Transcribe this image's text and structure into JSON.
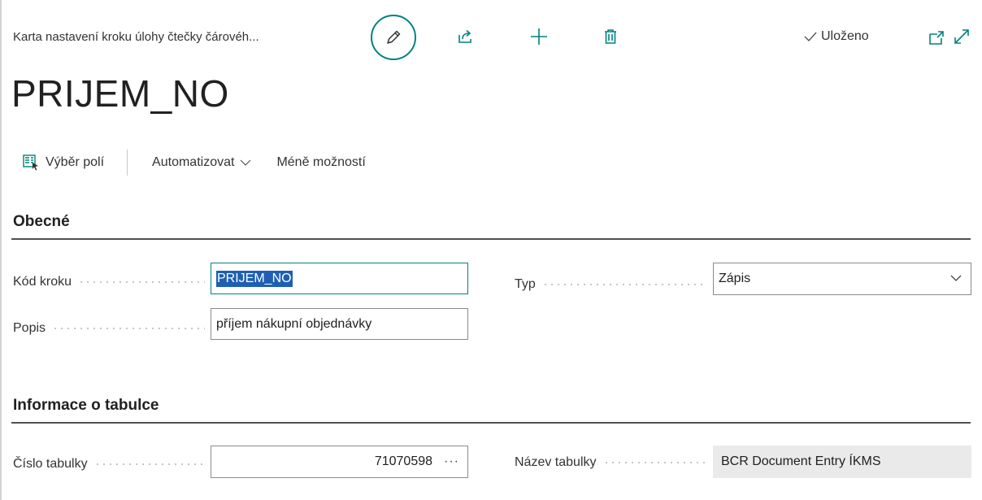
{
  "header": {
    "caption": "Karta nastavení kroku úlohy čtečky čárovéh...",
    "saved_label": "Uloženo",
    "icons": [
      "pencil-icon",
      "share-icon",
      "plus-icon",
      "trash-icon",
      "checkmark-icon",
      "open-new-window-icon",
      "expand-icon"
    ],
    "accent_color": "#00827f"
  },
  "title": "PRIJEM_NO",
  "actions": {
    "field_selection": "Výběr polí",
    "automate": "Automatizovat",
    "fewer_options": "Méně možností"
  },
  "general": {
    "heading": "Obecné",
    "step_code_label": "Kód kroku",
    "step_code_value": "PRIJEM_NO",
    "description_label": "Popis",
    "description_value": "příjem nákupní objednávky",
    "type_label": "Typ",
    "type_value": "Zápis"
  },
  "table_info": {
    "heading": "Informace o tabulce",
    "table_no_label": "Číslo tabulky",
    "table_no_value": "71070598",
    "table_no_ellipsis": "···",
    "table_name_label": "Název tabulky",
    "table_name_value": "BCR Document Entry ÍKMS"
  }
}
